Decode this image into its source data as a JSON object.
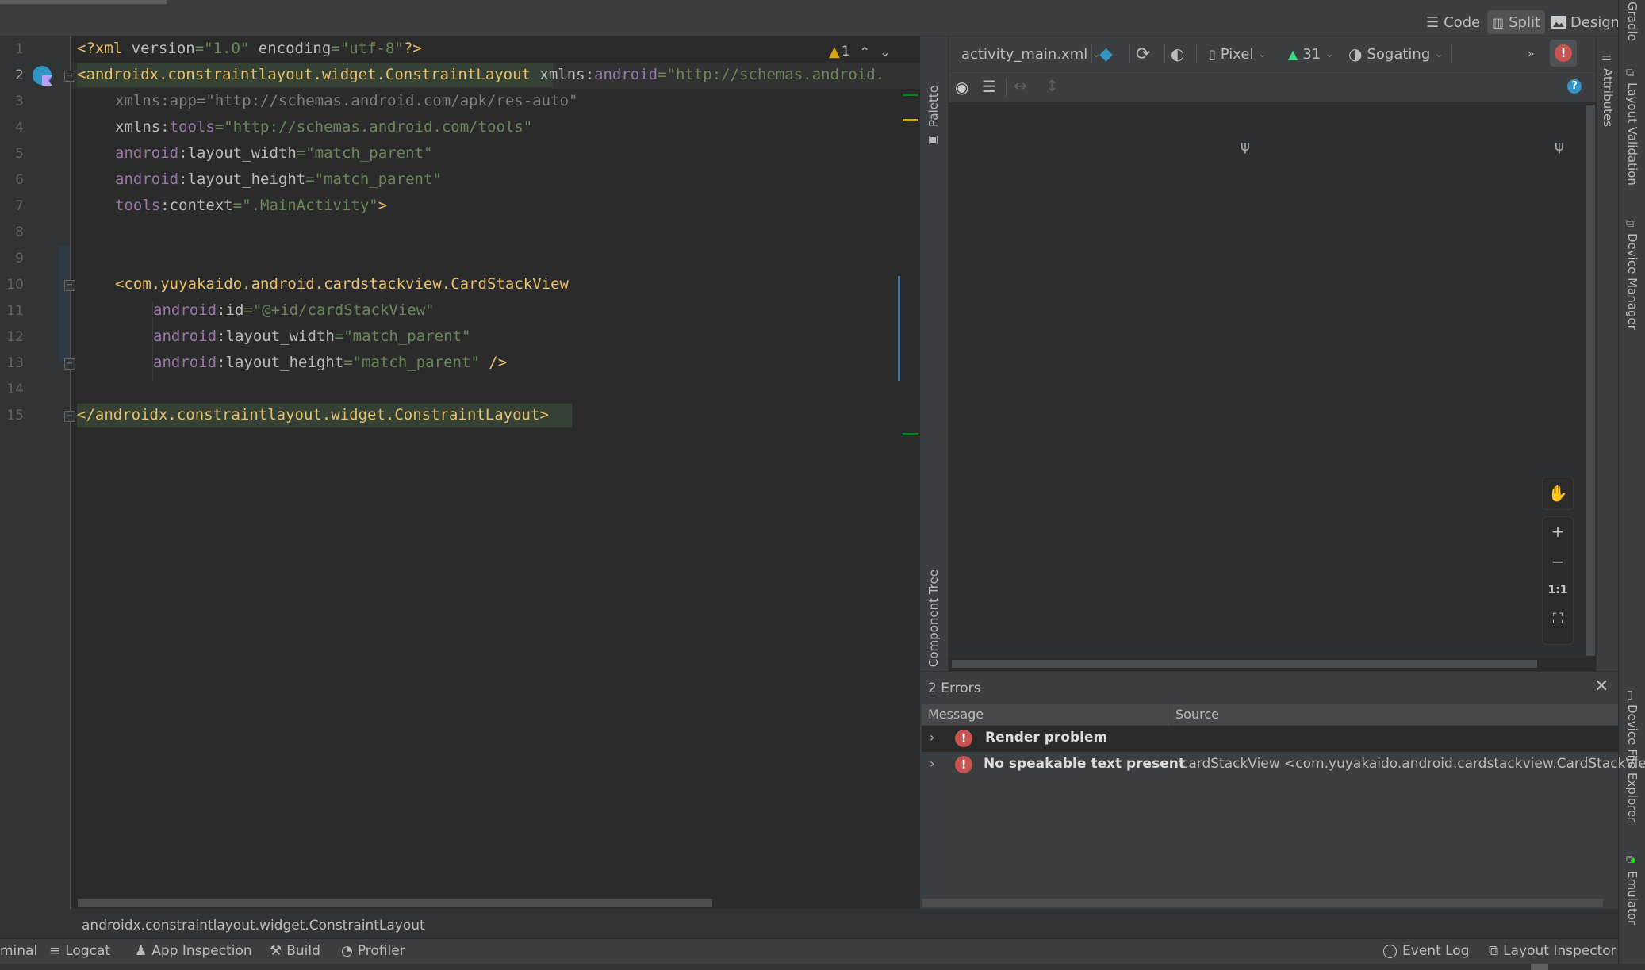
{
  "view_modes": {
    "code": "Code",
    "split": "Split",
    "design": "Design",
    "active": "Split"
  },
  "editor": {
    "lines": [
      {
        "n": "1"
      },
      {
        "n": "2"
      },
      {
        "n": "3"
      },
      {
        "n": "4"
      },
      {
        "n": "5"
      },
      {
        "n": "6"
      },
      {
        "n": "7"
      },
      {
        "n": "8"
      },
      {
        "n": "9"
      },
      {
        "n": "10"
      },
      {
        "n": "11"
      },
      {
        "n": "12"
      },
      {
        "n": "13"
      },
      {
        "n": "14"
      },
      {
        "n": "15"
      }
    ],
    "code": {
      "l1_open": "<?xml ",
      "l1_attr1": "version",
      "l1_val1": "=\"1.0\"",
      "l1_attr2": " encoding",
      "l1_val2": "=\"utf-8\"",
      "l1_close": "?>",
      "l2_tag": "<androidx.constraintlayout.widget.ConstraintLayout",
      "l2_attr": " xmlns:",
      "l2_ns": "android",
      "l2_val": "=\"http://schemas.android.",
      "l3": "xmlns:app=\"http://schemas.android.com/apk/res-auto\"",
      "l4_attr": "xmlns:",
      "l4_ns": "tools",
      "l4_val": "=\"http://schemas.android.com/tools\"",
      "l5_ns": "android",
      "l5_attr": ":layout_width",
      "l5_val": "=\"match_parent\"",
      "l6_ns": "android",
      "l6_attr": ":layout_height",
      "l6_val": "=\"match_parent\"",
      "l7_ns": "tools",
      "l7_attr": ":context",
      "l7_val": "=\".MainActivity\"",
      "l7_close": ">",
      "l10_tag": "<com.yuyakaido.android.cardstackview.CardStackView",
      "l11_ns": "android",
      "l11_attr": ":id",
      "l11_val": "=\"@+id/cardStackView\"",
      "l12_ns": "android",
      "l12_attr": ":layout_width",
      "l12_val": "=\"match_parent\"",
      "l13_ns": "android",
      "l13_attr": ":layout_height",
      "l13_val": "=\"match_parent\"",
      "l13_close": " />",
      "l15_tag": "</androidx.constraintlayout.widget.ConstraintLayout>"
    },
    "inspection": {
      "warning_count": "1",
      "prev": "^",
      "next": "v"
    },
    "colors": {
      "tag": "#e8bf6a",
      "namespace": "#9876aa",
      "value": "#6a8759",
      "warning": "#d9a40f"
    }
  },
  "design_panel": {
    "palette_label": "Palette",
    "component_tree_label": "Component Tree",
    "file_dropdown": "activity_main.xml",
    "device_dropdown": "Pixel",
    "api_dropdown": "31",
    "theme_dropdown": "Sogating",
    "more": "»",
    "zoom_controls": {
      "zoom_in": "+",
      "zoom_out": "−",
      "actual_size": "1:1"
    }
  },
  "errors_panel": {
    "title": "2 Errors",
    "columns": [
      "Message",
      "Source"
    ],
    "rows": [
      {
        "message": "Render problem",
        "source": ""
      },
      {
        "message": "No speakable text present",
        "source": "cardStackView <com.yuyakaido.android.cardstackview.CardStackView"
      }
    ]
  },
  "side_tabs": {
    "attributes": "Attributes",
    "gradle": "Gradle",
    "layout_validation": "Layout Validation",
    "device_manager": "Device Manager",
    "device_file_explorer": "Device File Explorer",
    "emulator": "Emulator"
  },
  "breadcrumb": "androidx.constraintlayout.widget.ConstraintLayout",
  "bottom_tools": {
    "terminal": "minal",
    "logcat": "Logcat",
    "app_inspection": "App Inspection",
    "build": "Build",
    "profiler": "Profiler",
    "event_log": "Event Log",
    "layout_inspector": "Layout Inspector"
  }
}
